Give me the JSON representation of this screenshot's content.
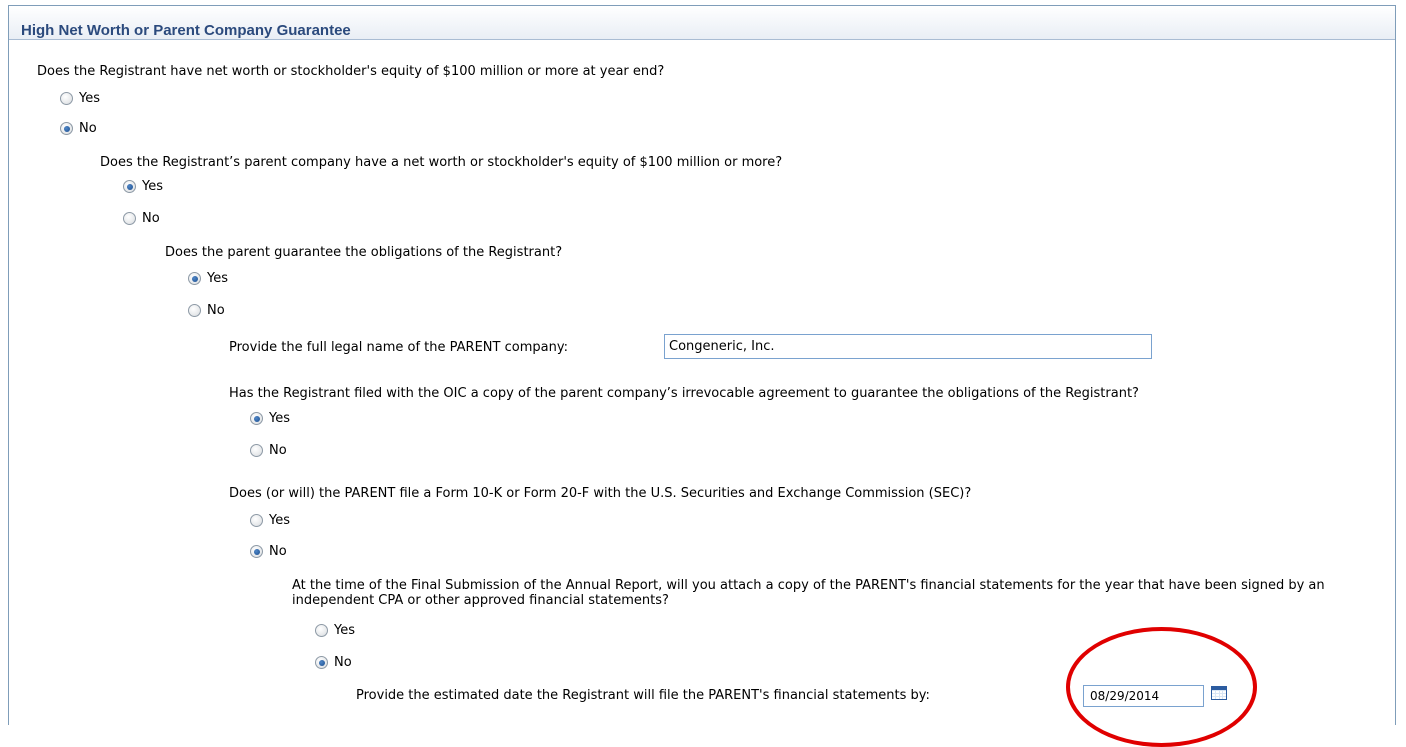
{
  "section": {
    "title": "High Net Worth or Parent Company Guarantee"
  },
  "q1": {
    "text": "Does the Registrant have net worth or stockholder's equity of $100 million or more at year end?",
    "yes": "Yes",
    "no": "No",
    "selected": "No"
  },
  "q2": {
    "text": "Does the Registrant’s parent company have a net worth or stockholder's equity of $100 million or more?",
    "yes": "Yes",
    "no": "No",
    "selected": "Yes"
  },
  "q3": {
    "text": "Does the parent guarantee the obligations of the Registrant?",
    "yes": "Yes",
    "no": "No",
    "selected": "Yes"
  },
  "q4": {
    "text": "Provide the full legal name of the PARENT company:",
    "value": "Congeneric, Inc."
  },
  "q5": {
    "text": "Has the Registrant filed with the OIC a copy of the parent company’s irrevocable agreement to guarantee the obligations of the Registrant?",
    "yes": "Yes",
    "no": "No",
    "selected": "Yes"
  },
  "q6": {
    "text": "Does (or will) the PARENT file a Form 10-K or Form 20-F with the U.S. Securities and Exchange Commission (SEC)?",
    "yes": "Yes",
    "no": "No",
    "selected": "No"
  },
  "q7": {
    "text": "At the time of the Final Submission of the Annual Report, will you attach a copy of the PARENT's financial statements for the year that have been signed by an independent CPA or other approved financial statements?",
    "yes": "Yes",
    "no": "No",
    "selected": "No"
  },
  "q8": {
    "text": "Provide the estimated date the Registrant will file the PARENT's financial statements by:",
    "value": "08/29/2014"
  },
  "icons": {
    "calendar": "calendar-icon"
  },
  "colors": {
    "title": "#2b4a7d",
    "border": "#7f9db9",
    "highlight": "#e00000"
  }
}
